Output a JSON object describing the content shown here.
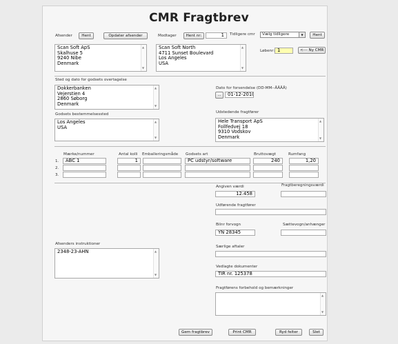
{
  "title": "CMR Fragtbrev",
  "sender": {
    "label": "Afsender",
    "fetch_button": "Hent",
    "update_button": "Opdater afsender",
    "lines": [
      "Scan Soft ApS",
      "Skalhuse 5",
      "9240 Nibe",
      "Denmark"
    ]
  },
  "receiver": {
    "label": "Modtager",
    "fetch_nr_button": "Hent nr:",
    "nr_value": "1",
    "previous_label": "Tidligere cmr",
    "previous_select": "Vælg tidligere",
    "previous_fetch_button": "Hent",
    "lines": [
      "Scan Soft North",
      "4711 Sunset Boulevard",
      "Los Angeles",
      "USA"
    ]
  },
  "serial": {
    "label": "Løbenr:",
    "value": "1",
    "new_cmr_button": "<--- Ny CMR"
  },
  "takeover": {
    "label": "Sted og dato for godsets overtagelse",
    "lines": [
      "Dokkerbanken",
      "Vejerstien 4",
      "2860 Søborg",
      "Denmark"
    ]
  },
  "ship_date": {
    "label": "Dato for forsendelse (DD-MM--ÅÅÅÅ)",
    "picker_button": "...",
    "value": "01-12-2010"
  },
  "destination": {
    "label": "Godsets bestemmelsessted",
    "lines": [
      "Los Angeles",
      "USA"
    ]
  },
  "carrier_issuing": {
    "label": "Udstedende fragtfører",
    "lines": [
      "Hele Transport ApS",
      "Follfedvej 18",
      "9310 Vodskov",
      "Denmark"
    ]
  },
  "goods": {
    "headers": [
      "Mærke/nummer",
      "Antal kolli",
      "Emballeringsmåde",
      "Godsets art",
      "Bruttovægt",
      "Rumfang"
    ],
    "rows": [
      {
        "no": "1.",
        "mark": "ABC 1",
        "count": "1",
        "packing": "",
        "kind": "PC udstyr/software",
        "weight": "240",
        "volume": "1,20"
      },
      {
        "no": "2.",
        "mark": "",
        "count": "",
        "packing": "",
        "kind": "",
        "weight": "",
        "volume": ""
      },
      {
        "no": "3.",
        "mark": "",
        "count": "",
        "packing": "",
        "kind": "",
        "weight": "",
        "volume": ""
      }
    ]
  },
  "declared_value": {
    "label": "Angiven værdi",
    "value": "12.458"
  },
  "freight_calc": {
    "label": "Fragtberegningsværdi",
    "value": ""
  },
  "executing_carrier": {
    "label": "Udførende fragtfører",
    "value": ""
  },
  "vehicle": {
    "label": "Bilnr forvogn",
    "value": "YN 28345"
  },
  "trailer": {
    "label": "Sættevogn/anhænger",
    "value": ""
  },
  "special": {
    "label": "Særlige aftaler",
    "value": ""
  },
  "instructions": {
    "label": "Afsenders instruktioner",
    "lines": [
      "2348-23-AHN"
    ]
  },
  "documents": {
    "label": "Vedlagte dokumenter",
    "value": "TIR nr. 125378"
  },
  "reservations": {
    "label": "Fragtførens forbehold og bemærkninger",
    "lines": []
  },
  "actions": {
    "save": "Gem fragtbrev",
    "print": "Print CMR",
    "clear": "Ryd felter",
    "delete": "Slet"
  }
}
